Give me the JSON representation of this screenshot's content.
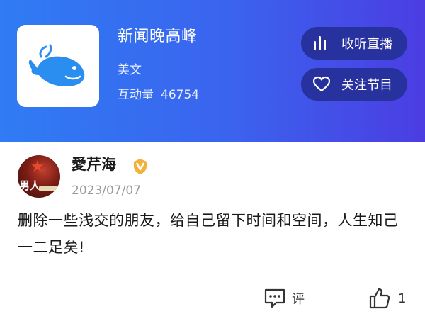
{
  "header": {
    "show_title": "新闻晚高峰",
    "host": "美文",
    "interaction_label": "互动量",
    "interaction_count": "46754",
    "listen_live_label": "收听直播",
    "follow_label": "关注节目",
    "logo_icon": "whale-icon",
    "colors": {
      "gradient_start": "#2f7cf4",
      "gradient_end": "#4b3de2",
      "pill_bg": "#28329e"
    }
  },
  "post": {
    "username": "愛芹海",
    "avatar_text": "男人",
    "date": "2023/07/07",
    "body": "删除一些浅交的朋友，给自己留下时间和空间，人生知己一二足矣!",
    "badge_icon": "vip-v-icon",
    "badge_color": "#f0b23a"
  },
  "actions": {
    "comment_label": "评",
    "like_count": "1",
    "comment_icon": "comment-icon",
    "like_icon": "thumbs-up-icon"
  }
}
